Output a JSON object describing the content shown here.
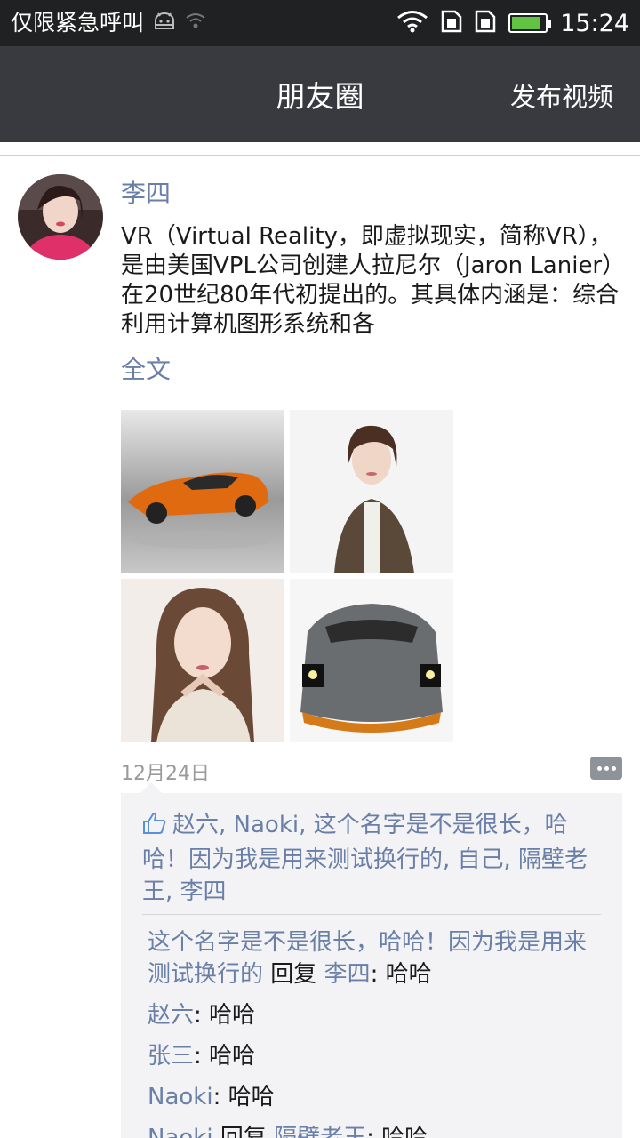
{
  "status_bar": {
    "carrier_text": "仅限紧急呼叫",
    "time": "15:24",
    "battery_level": 0.85,
    "icons": [
      "android-icon",
      "wifi-weak-icon",
      "wifi-icon",
      "sim-icon",
      "sim-icon",
      "battery-charging-icon"
    ]
  },
  "header": {
    "title": "朋友圈",
    "action": "发布视频"
  },
  "post": {
    "author": "李四",
    "text": "VR（Virtual Reality，即虚拟现实，简称VR），是由美国VPL公司创建人拉尼尔（Jaron Lanier）在20世纪80年代初提出的。其具体内涵是：综合利用计算机图形系统和各",
    "full_text_link": "全文",
    "photos": [
      "orange-sports-car-photo",
      "woman-portrait-photo",
      "woman-closeup-photo",
      "gray-sports-car-photo"
    ],
    "date": "12月24日"
  },
  "likes": {
    "names": "赵六, Naoki, 这个名字是不是很长，哈哈！因为我是用来测试换行的, 自己, 隔壁老王, 李四"
  },
  "comments": [
    {
      "user": "这个名字是不是很长，哈哈！因为我是用来测试换行的",
      "reply_word": "回复",
      "reply_to": "李四",
      "text": "哈哈"
    },
    {
      "user": "赵六",
      "text": "哈哈"
    },
    {
      "user": "张三",
      "text": "哈哈"
    },
    {
      "user": "Naoki",
      "text": "哈哈"
    },
    {
      "user": "Naoki",
      "reply_word": "回复",
      "reply_to": "隔壁老王",
      "text": "哈哈"
    }
  ],
  "colors": {
    "header_bg": "#393a3f",
    "status_bg": "#1f2122",
    "link_blue": "#6a7fa8",
    "comment_bg": "#f3f3f5"
  }
}
